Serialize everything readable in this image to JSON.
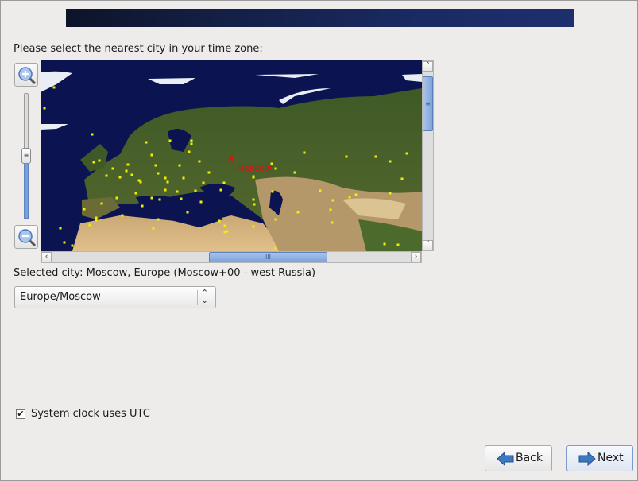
{
  "prompt": "Please select the nearest city in your time zone:",
  "map": {
    "selected_marker_label": "Moscow",
    "marker_color": "#e01010",
    "city_dot_color": "#f0f000"
  },
  "selected_city_text": "Selected city: Moscow, Europe (Moscow+00 - west Russia)",
  "timezone_select": {
    "value": "Europe/Moscow"
  },
  "utc_checkbox": {
    "label": "System clock uses UTC",
    "checked": true,
    "mark": "✔"
  },
  "buttons": {
    "back": "Back",
    "next": "Next"
  },
  "scroll": {
    "grip": "≡",
    "hgrip": "III",
    "up": "˄",
    "down": "˅",
    "left": "‹",
    "right": "›"
  }
}
